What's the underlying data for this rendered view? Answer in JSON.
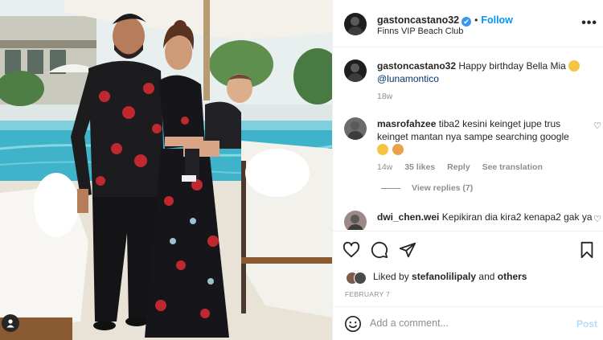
{
  "post": {
    "author": "gastoncastano32",
    "verified": "✔",
    "separator": "•",
    "follow_label": "Follow",
    "location": "Finns VIP Beach Club",
    "more_label": "•••"
  },
  "caption": {
    "author": "gastoncastano32",
    "text": "Happy birthday Bella Mia",
    "mention": "@lunamontico",
    "time": "18w"
  },
  "comments": [
    {
      "author": "masrofahzee",
      "text": "tiba2 kesini keinget jupe trus keinget mantan nya sampe searching google",
      "time": "14w",
      "likes": "35 likes",
      "reply_label": "Reply",
      "translate_label": "See translation",
      "view_replies": "View replies (7)"
    },
    {
      "author": "dwi_chen.wei",
      "text": "Kepikiran dia kira2 kenapa2 gak ya"
    }
  ],
  "likes": {
    "prefix": "Liked by",
    "user": "stefanolilipaly",
    "conjunction": "and",
    "others": "others"
  },
  "date": "FEBRUARY 7",
  "composer": {
    "placeholder": "Add a comment...",
    "post_label": "Post"
  },
  "icons": {
    "heart": "heart-icon",
    "comment": "comment-bubble-icon",
    "share": "paper-plane-icon",
    "save": "bookmark-icon",
    "emoji": "smiley-face-icon",
    "user_tag": "user-tag-icon",
    "more": "ellipsis-icon"
  },
  "colors": {
    "link_blue": "#0095f6",
    "mention_blue": "#00376b",
    "verified_blue": "#3897f0",
    "muted_text": "#8e8e8e",
    "post_disabled": "#b3dbff",
    "divider": "#efefef"
  }
}
